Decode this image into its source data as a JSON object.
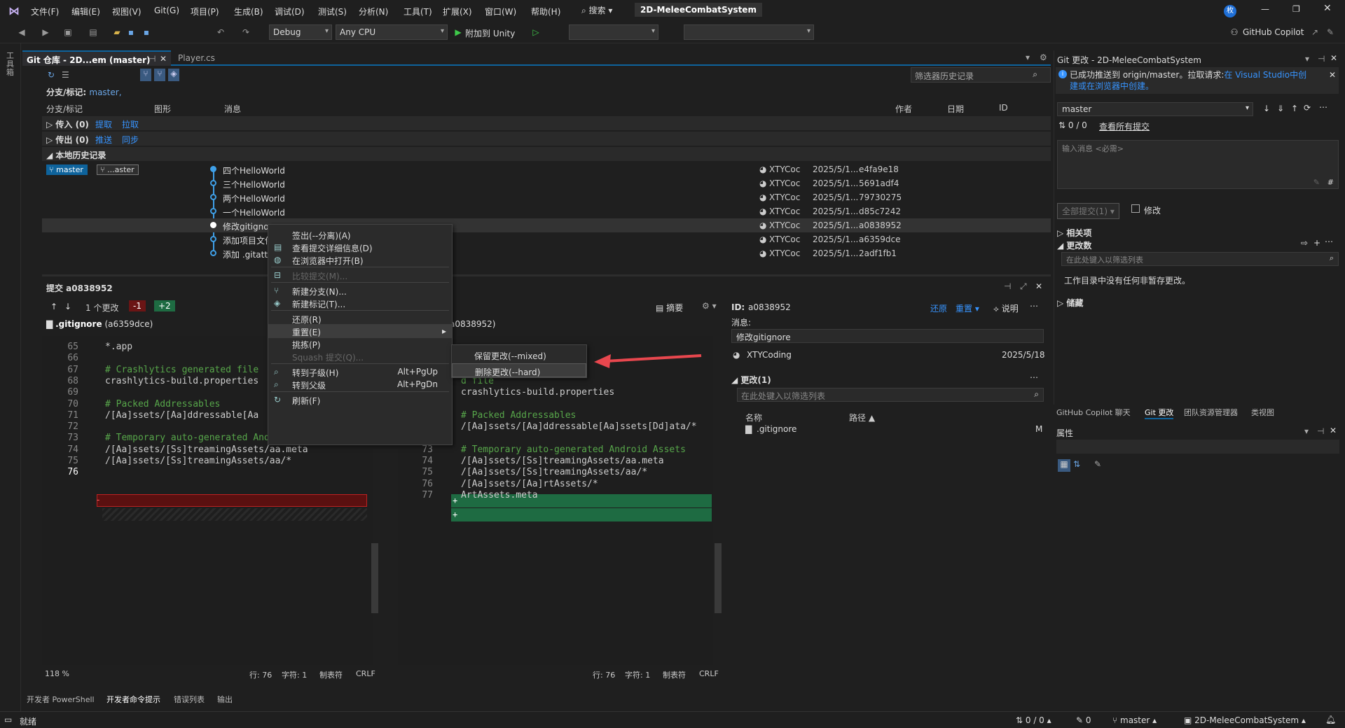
{
  "menubar": {
    "items": [
      "文件(F)",
      "编辑(E)",
      "视图(V)",
      "Git(G)",
      "项目(P)",
      "生成(B)",
      "调试(D)",
      "测试(S)",
      "分析(N)",
      "工具(T)",
      "扩展(X)",
      "窗口(W)",
      "帮助(H)"
    ],
    "search": "搜索",
    "title": "2D-MeleeCombatSystem"
  },
  "toolbar": {
    "config": "Debug",
    "platform": "Any CPU",
    "attach": "附加到 Unity",
    "copilot": "GitHub Copilot"
  },
  "tabs": {
    "git_repo": "Git 仓库 - 2D...em (master)",
    "player": "Player.cs"
  },
  "history": {
    "filter_placeholder": "筛选器历史记录",
    "branch_label": "分支/标记:",
    "branch_value": "master,",
    "columns": {
      "branch": "分支/标记",
      "graph": "图形",
      "message": "消息",
      "author": "作者",
      "date": "日期",
      "id": "ID"
    },
    "incoming": "传入 (0)",
    "fetch": "提取",
    "pull": "拉取",
    "outgoing": "传出 (0)",
    "push": "推送",
    "sync": "同步",
    "local": "本地历史记录",
    "badge_master": "master",
    "badge_other": "...aster",
    "commits": [
      {
        "msg": "四个HelloWorld",
        "author": "XTYCoc",
        "date": "2025/5/1...",
        "id": "e4fa9e18"
      },
      {
        "msg": "三个HelloWorld",
        "author": "XTYCoc",
        "date": "2025/5/1...",
        "id": "5691adf4"
      },
      {
        "msg": "两个HelloWorld",
        "author": "XTYCoc",
        "date": "2025/5/1...",
        "id": "79730275"
      },
      {
        "msg": "一个HelloWorld",
        "author": "XTYCoc",
        "date": "2025/5/1...",
        "id": "d85c7242"
      },
      {
        "msg": "修改gitignore",
        "author": "XTYCoc",
        "date": "2025/5/1...",
        "id": "a0838952"
      },
      {
        "msg": "添加项目文件",
        "author": "XTYCoc",
        "date": "2025/5/1...",
        "id": "a6359dce"
      },
      {
        "msg": "添加 .gitattr",
        "author": "XTYCoc",
        "date": "2025/5/1...",
        "id": "2adf1fb1"
      }
    ]
  },
  "context_menu": {
    "items": [
      {
        "label": "签出(--分离)(A)",
        "enabled": true
      },
      {
        "label": "查看提交详细信息(D)",
        "enabled": true
      },
      {
        "label": "在浏览器中打开(B)",
        "enabled": true
      },
      {
        "label": "比较提交(M)...",
        "enabled": false
      },
      {
        "label": "新建分支(N)...",
        "enabled": true
      },
      {
        "label": "新建标记(T)...",
        "enabled": true
      },
      {
        "label": "还原(R)",
        "enabled": true
      },
      {
        "label": "重置(E)",
        "enabled": true
      },
      {
        "label": "挑拣(P)",
        "enabled": true
      },
      {
        "label": "Squash 提交(Q)...",
        "enabled": false
      },
      {
        "label": "转到子级(H)",
        "enabled": true,
        "shortcut": "Alt+PgUp"
      },
      {
        "label": "转到父级",
        "enabled": true,
        "shortcut": "Alt+PgDn"
      },
      {
        "label": "刷新(F)",
        "enabled": true
      }
    ],
    "submenu": [
      "保留更改(--mixed)",
      "删除更改(--hard)"
    ]
  },
  "commit_panel": {
    "title": "提交 a0838952",
    "changes_count": "1 个更改",
    "minus": "-1",
    "plus": "+2",
    "file": ".gitignore",
    "file_ref": "(a6359dce)",
    "right_ref": "a0838952)",
    "summary": "摘要"
  },
  "diff": {
    "left": [
      {
        "n": "65",
        "t": "*.app"
      },
      {
        "n": "66",
        "t": ""
      },
      {
        "n": "67",
        "t": "# Crashlytics generated file",
        "c": true
      },
      {
        "n": "68",
        "t": "crashlytics-build.properties"
      },
      {
        "n": "69",
        "t": ""
      },
      {
        "n": "70",
        "t": "# Packed Addressables",
        "c": true
      },
      {
        "n": "71",
        "t": "/[Aa]ssets/[Aa]ddressable[Aa"
      },
      {
        "n": "72",
        "t": ""
      },
      {
        "n": "73",
        "t": "# Temporary auto-generated Android Assets",
        "c": true
      },
      {
        "n": "74",
        "t": "/[Aa]ssets/[Ss]treamingAssets/aa.meta"
      },
      {
        "n": "75",
        "t": "/[Aa]ssets/[Ss]treamingAssets/aa/*"
      },
      {
        "n": "76",
        "t": ""
      }
    ],
    "right": [
      {
        "n": "",
        "t": "d file",
        "c": true
      },
      {
        "n": "",
        "t": "crashlytics-build.properties"
      },
      {
        "n": "",
        "t": ""
      },
      {
        "n": "",
        "t": "# Packed Addressables",
        "c": true
      },
      {
        "n": "",
        "t": "/[Aa]ssets/[Aa]ddressable[Aa]ssets[Dd]ata/*"
      },
      {
        "n": "",
        "t": ""
      },
      {
        "n": "73",
        "t": "# Temporary auto-generated Android Assets",
        "c": true
      },
      {
        "n": "74",
        "t": "/[Aa]ssets/[Ss]treamingAssets/aa.meta"
      },
      {
        "n": "75",
        "t": "/[Aa]ssets/[Ss]treamingAssets/aa/*"
      },
      {
        "n": "76",
        "t": "/[Aa]ssets/[Aa]rtAssets/*"
      },
      {
        "n": "77",
        "t": "ArtAssets.meta"
      }
    ],
    "left_status": {
      "zoom": "118 %",
      "line": "行: 76",
      "char": "字符: 1",
      "tab": "制表符",
      "eol": "CRLF"
    },
    "right_status": {
      "line": "行: 76",
      "char": "字符: 1",
      "tab": "制表符",
      "eol": "CRLF"
    }
  },
  "details": {
    "id_label": "ID:",
    "id": "a0838952",
    "revert": "还原",
    "reset": "重置",
    "explain": "说明",
    "msg_label": "消息:",
    "msg": "修改gitignore",
    "author": "XTYCoding",
    "date": "2025/5/18",
    "changes": "更改(1)",
    "filter_placeholder": "在此处键入以筛选列表",
    "col_name": "名称",
    "col_path": "路径",
    "file": ".gitignore",
    "status": "M"
  },
  "git_changes": {
    "title": "Git 更改 - 2D-MeleeCombatSystem",
    "info": "已成功推送到 origin/master。拉取请求:",
    "info_link1": "在 Visual Studio中创",
    "info_link2": "建或在浏览器中创建。",
    "branch": "master",
    "counts": "0 / 0",
    "view_all": "查看所有提交",
    "msg_placeholder": "输入消息 <必需>",
    "commit_all": "全部提交(1)",
    "amend": "修改",
    "related": "相关项",
    "changes": "更改数",
    "filter_placeholder": "在此处键入以筛选列表",
    "no_changes": "工作目录中没有任何非暂存更改。",
    "stash": "储藏"
  },
  "right_tabs": [
    "GitHub Copilot 聊天",
    "Git 更改",
    "团队资源管理器",
    "类视图"
  ],
  "properties": {
    "title": "属性"
  },
  "bottom_tabs": [
    "开发者 PowerShell",
    "开发者命令提示",
    "错误列表",
    "输出"
  ],
  "statusbar": {
    "ready": "就绪",
    "counts": "0 / 0",
    "pencil": "0",
    "branch": "master",
    "repo": "2D-MeleeCombatSystem"
  },
  "colors": {
    "accent": "#0e639c",
    "added": "#1e6b42",
    "removed": "#6b1515",
    "arrow": "#e8474e"
  }
}
